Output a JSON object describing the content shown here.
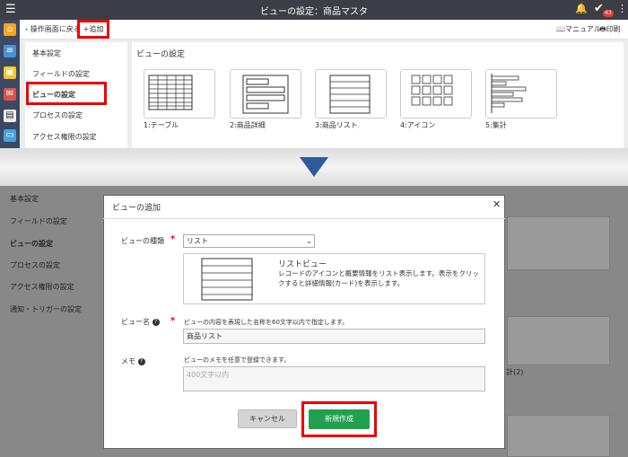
{
  "app": {
    "title": "ビューの設定：商品マスタ",
    "menu_icon": "hamburger-icon",
    "notification_count": "43"
  },
  "toolbar": {
    "back_label": "操作画面に戻る",
    "add_label": "追加",
    "manual_label": "マニュアル",
    "print_label": "印刷"
  },
  "settings_nav": {
    "items": [
      {
        "label": "基本設定"
      },
      {
        "label": "フィールドの設定"
      },
      {
        "label": "ビューの設定"
      },
      {
        "label": "プロセスの設定"
      },
      {
        "label": "アクセス権限の設定"
      },
      {
        "label": "通知・トリガーの設定"
      }
    ]
  },
  "view_panel": {
    "title": "ビューの設定",
    "cards": [
      {
        "label": "1:テーブル",
        "icon": "table-icon"
      },
      {
        "label": "2:商品詳細",
        "icon": "detail-icon"
      },
      {
        "label": "3:商品リスト",
        "icon": "list-icon"
      },
      {
        "label": "4:アイコン",
        "icon": "grid-icon"
      },
      {
        "label": "5:集計",
        "icon": "bar-chart-icon"
      }
    ]
  },
  "background": {
    "partial_label": "計(2)"
  },
  "modal": {
    "title": "ビューの追加",
    "view_type": {
      "label": "ビューの種類",
      "selected": "リスト",
      "preview_title": "リストビュー",
      "preview_desc": "レコードのアイコンと概要情報をリスト表示します。表示をクリックすると詳細情報(カード)を表示します。"
    },
    "view_name": {
      "label": "ビュー名",
      "hint": "ビューの内容を表現した名称を60文字以内で指定します。",
      "value": "商品リスト"
    },
    "memo": {
      "label": "メモ",
      "hint": "ビューのメモを任意で登録できます。",
      "placeholder": "400文字以内"
    },
    "cancel_label": "キャンセル",
    "create_label": "新規作成"
  },
  "colors": {
    "topbar": "#3d3d45",
    "rail": "#3b4a62",
    "primary_action": "#21a050",
    "highlight": "#ee0000",
    "arrow": "#2e5b9a"
  }
}
